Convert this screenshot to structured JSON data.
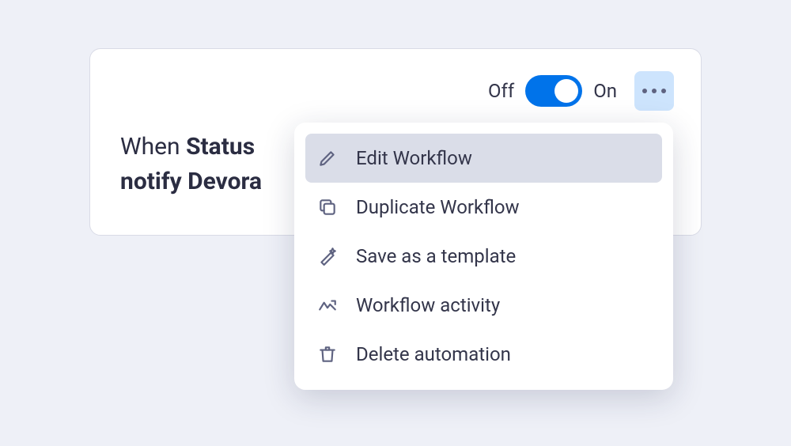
{
  "card": {
    "toggle": {
      "off_label": "Off",
      "on_label": "On",
      "state": "on"
    },
    "rule": {
      "prefix": "When ",
      "bold1": "Status",
      "line2_prefix": "notify ",
      "bold2": "Devora"
    }
  },
  "menu": {
    "items": [
      {
        "icon": "pencil-icon",
        "label": "Edit Workflow",
        "selected": true
      },
      {
        "icon": "copy-icon",
        "label": "Duplicate Workflow",
        "selected": false
      },
      {
        "icon": "wand-icon",
        "label": "Save as a template",
        "selected": false
      },
      {
        "icon": "activity-icon",
        "label": "Workflow activity",
        "selected": false
      },
      {
        "icon": "trash-icon",
        "label": "Delete automation",
        "selected": false
      }
    ]
  }
}
